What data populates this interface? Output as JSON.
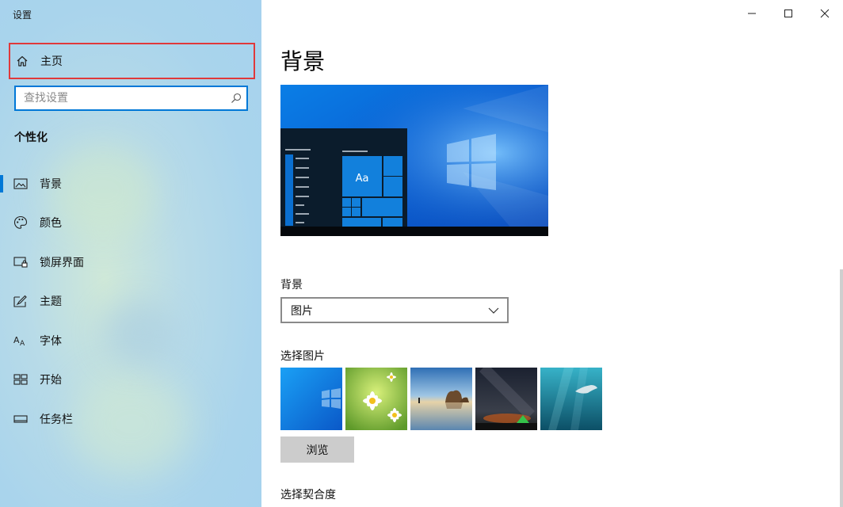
{
  "window": {
    "title": "设置",
    "controls": [
      {
        "name": "minimize-button",
        "icon": "minimize-icon"
      },
      {
        "name": "maximize-button",
        "icon": "maximize-icon"
      },
      {
        "name": "close-button",
        "icon": "close-icon"
      }
    ]
  },
  "sidebar": {
    "home": {
      "label": "主页",
      "icon": "home-icon"
    },
    "search": {
      "placeholder": "查找设置",
      "value": "",
      "icon": "search-icon"
    },
    "section_title": "个性化",
    "items": [
      {
        "id": "background",
        "label": "背景",
        "icon": "picture-icon",
        "active": true
      },
      {
        "id": "colors",
        "label": "颜色",
        "icon": "palette-icon",
        "active": false
      },
      {
        "id": "lock-screen",
        "label": "锁屏界面",
        "icon": "lock-screen-icon",
        "active": false
      },
      {
        "id": "themes",
        "label": "主题",
        "icon": "theme-brush-icon",
        "active": false
      },
      {
        "id": "fonts",
        "label": "字体",
        "icon": "font-icon",
        "active": false
      },
      {
        "id": "start",
        "label": "开始",
        "icon": "start-tiles-icon",
        "active": false
      },
      {
        "id": "taskbar",
        "label": "任务栏",
        "icon": "taskbar-icon",
        "active": false
      }
    ]
  },
  "main": {
    "title": "背景",
    "preview": {
      "sample_text": "Aa"
    },
    "background_field": {
      "label": "背景",
      "value": "图片"
    },
    "choose_picture": {
      "label": "选择图片",
      "thumbnails": [
        "windows-blue",
        "daisies",
        "beach-rocks",
        "night-sky-tent",
        "underwater-diver"
      ]
    },
    "browse_label": "浏览",
    "fit_label": "选择契合度"
  },
  "colors": {
    "accent": "#0078d7",
    "highlight_border": "#e0393b",
    "sidebar_bg": "#a9d4ec",
    "button_bg": "#cccccc"
  }
}
